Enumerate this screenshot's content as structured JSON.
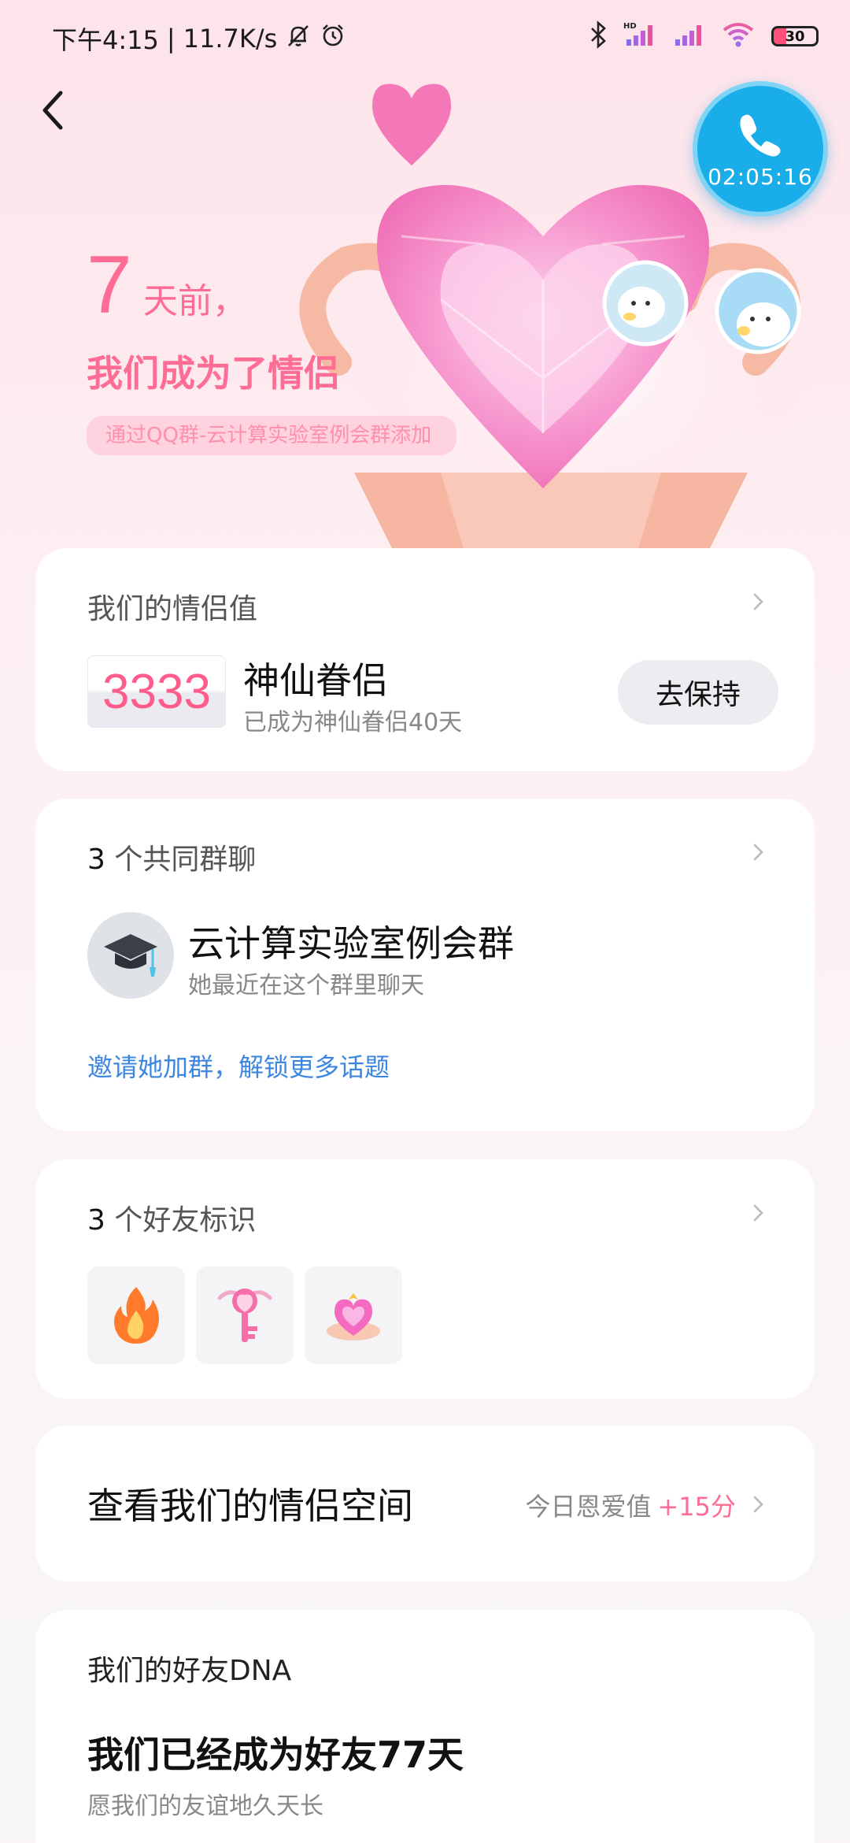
{
  "status_bar": {
    "time": "下午4:15",
    "speed": "11.7K/s",
    "battery": "30",
    "hd_label": "HD"
  },
  "call": {
    "duration": "02:05:16",
    "color": "#19aee9"
  },
  "hero": {
    "days_number": "7",
    "days_unit": "天前，",
    "became_text": "我们成为了情侣",
    "via_text": "通过QQ群-云计算实验室例会群添加"
  },
  "couple_value": {
    "label": "我们的情侣值",
    "score": "3333",
    "level": "神仙眷侣",
    "level_desc": "已成为神仙眷侣40天",
    "button": "去保持"
  },
  "groups": {
    "count": "3",
    "label": "个共同群聊",
    "group_name": "云计算实验室例会群",
    "group_desc": "她最近在这个群里聊天",
    "invite_text": "邀请她加群，解锁更多话题"
  },
  "badges": {
    "count": "3",
    "label": "个好友标识",
    "items": [
      "flame-badge-icon",
      "key-badge-icon",
      "heart-crown-badge-icon"
    ]
  },
  "space": {
    "title": "查看我们的情侣空间",
    "today_label": "今日恩爱值",
    "today_value": "+15分"
  },
  "dna": {
    "label": "我们的好友DNA",
    "title": "我们已经成为好友77天",
    "desc": "愿我们的友谊地久天长"
  },
  "colors": {
    "accent_pink": "#ff6d94",
    "link_blue": "#3d86e0"
  }
}
